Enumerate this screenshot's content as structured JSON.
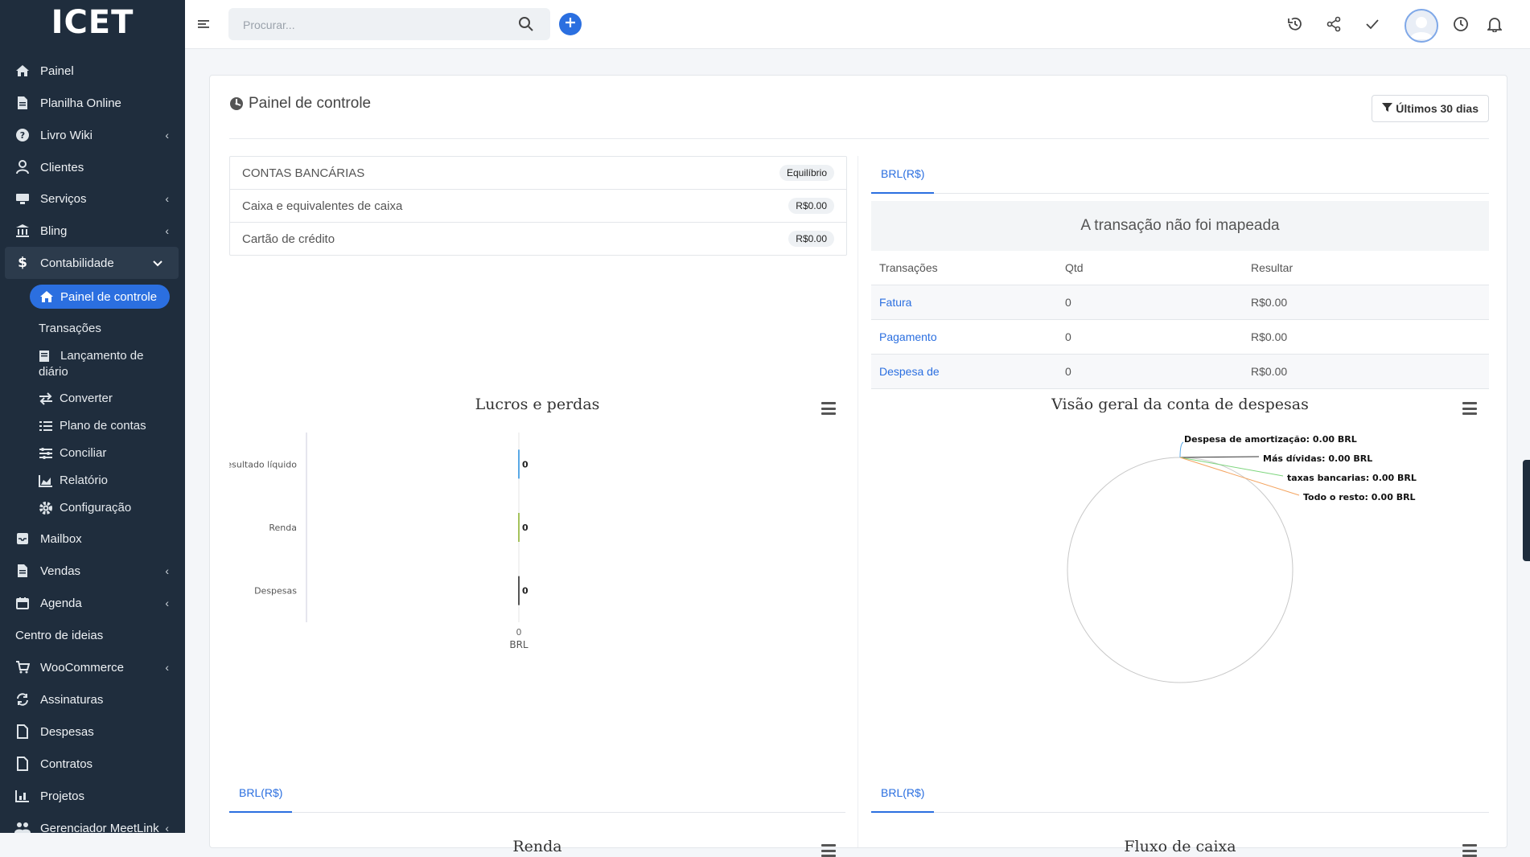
{
  "app": {
    "logo": "ICET"
  },
  "sidebar": {
    "items": [
      {
        "label": "Painel",
        "icon": "home-icon",
        "chevron": ""
      },
      {
        "label": "Planilha Online",
        "icon": "file-icon",
        "chevron": ""
      },
      {
        "label": "Livro Wiki",
        "icon": "question-icon",
        "chevron": "‹"
      },
      {
        "label": "Clientes",
        "icon": "user-icon",
        "chevron": ""
      },
      {
        "label": "Serviços",
        "icon": "services-icon",
        "chevron": "‹"
      },
      {
        "label": "Bling",
        "icon": "bank-icon",
        "chevron": "‹"
      },
      {
        "label": "Contabilidade",
        "icon": "dollar-icon",
        "chevron": "⌄"
      }
    ],
    "sub_items": {
      "active": "Painel de controle",
      "items": [
        {
          "label": "Transações",
          "icon": ""
        },
        {
          "label": "Lançamento de diário",
          "icon": "journal-icon"
        },
        {
          "label": "Converter",
          "icon": "exchange-icon"
        },
        {
          "label": "Plano de contas",
          "icon": "list-icon"
        },
        {
          "label": "Conciliar",
          "icon": "sliders-icon"
        },
        {
          "label": "Relatório",
          "icon": "chart-area-icon"
        },
        {
          "label": "Configuração",
          "icon": "cog-icon"
        }
      ]
    },
    "bottom_items": [
      {
        "label": "Mailbox",
        "icon": "mailbox-icon",
        "chevron": ""
      },
      {
        "label": "Vendas",
        "icon": "file-icon",
        "chevron": "‹"
      },
      {
        "label": "Agenda",
        "icon": "calendar-icon",
        "chevron": "‹"
      },
      {
        "label": "Centro de ideias",
        "icon": "",
        "chevron": ""
      },
      {
        "label": "WooCommerce",
        "icon": "cart-icon",
        "chevron": "‹"
      },
      {
        "label": "Assinaturas",
        "icon": "sync-icon",
        "chevron": ""
      },
      {
        "label": "Despesas",
        "icon": "file-icon",
        "chevron": ""
      },
      {
        "label": "Contratos",
        "icon": "file-icon",
        "chevron": ""
      },
      {
        "label": "Projetos",
        "icon": "chart-bar-icon",
        "chevron": ""
      },
      {
        "label": "Gerenciador MeetLink",
        "icon": "users-icon",
        "chevron": "‹"
      }
    ]
  },
  "topbar": {
    "search_placeholder": "Procurar..."
  },
  "dashboard": {
    "title": "Painel de controle",
    "filter_label": "Últimos 30 dias",
    "bank_accounts": {
      "header": "CONTAS BANCÁRIAS",
      "header_badge": "Equilíbrio",
      "rows": [
        {
          "label": "Caixa e equivalentes de caixa",
          "value": "R$0.00"
        },
        {
          "label": "Cartão de crédito",
          "value": "R$0.00"
        }
      ]
    },
    "currency_tab": "BRL(R$)",
    "unmapped_message": "A transação não foi mapeada",
    "transactions": {
      "columns": [
        "Transações",
        "Qtd",
        "Resultar"
      ],
      "rows": [
        [
          "Fatura",
          "0",
          "R$0.00"
        ],
        [
          "Pagamento",
          "0",
          "R$0.00"
        ],
        [
          "Despesa de",
          "0",
          "R$0.00"
        ]
      ]
    },
    "bottom_tabs": [
      "BRL(R$)",
      "BRL(R$)"
    ],
    "bottom_chart_titles": [
      "Renda",
      "Fluxo de caixa"
    ]
  },
  "chart_data": [
    {
      "type": "bar",
      "title": "Lucros e perdas",
      "orientation": "horizontal",
      "categories": [
        "Resultado líquido",
        "Renda",
        "Despesas"
      ],
      "values": [
        0,
        0,
        0
      ],
      "data_labels": [
        "0",
        "0",
        "0"
      ],
      "colors": [
        "#5aa9e6",
        "#a5c25c",
        "#555555"
      ],
      "x_ticks": [
        "0"
      ],
      "xlabel": "BRL"
    },
    {
      "type": "pie",
      "title": "Visão geral da conta de despesas",
      "slices": [
        {
          "label": "Despesa de amortização",
          "value": 0,
          "text": "Despesa de amortização: 0.00 BRL",
          "color": "#5aa9e6"
        },
        {
          "label": "Más dívidas",
          "value": 0,
          "text": "Más dívidas: 0.00 BRL",
          "color": "#333333"
        },
        {
          "label": "taxas bancarias",
          "value": 0,
          "text": "taxas bancarias: 0.00 BRL",
          "color": "#7ed67e"
        },
        {
          "label": "Todo o resto",
          "value": 0,
          "text": "Todo o resto: 0.00 BRL",
          "color": "#f4a460"
        }
      ]
    }
  ]
}
